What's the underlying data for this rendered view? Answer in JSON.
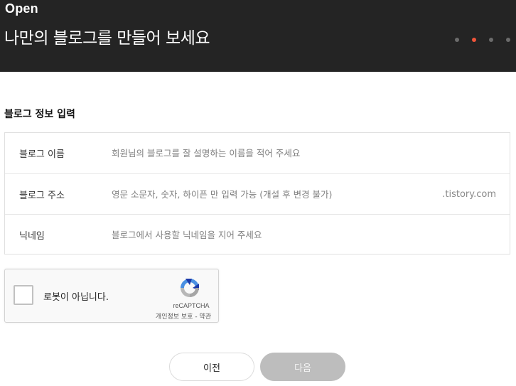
{
  "header": {
    "brand": "Open",
    "headline": "나만의 블로그를 만들어 보세요",
    "steps": {
      "total": 4,
      "active_index": 1
    },
    "colors": {
      "background": "#242424",
      "active_step": "#f0553a",
      "inactive_step": "#6b6b6b"
    }
  },
  "form": {
    "section_title": "블로그 정보 입력",
    "fields": [
      {
        "label": "블로그 이름",
        "value": "",
        "placeholder": "회원님의 블로그를 잘 설명하는 이름을 적어 주세요"
      },
      {
        "label": "블로그 주소",
        "value": "",
        "placeholder": "영문 소문자, 숫자, 하이픈 만 입력 가능 (개설 후 변경 불가)",
        "suffix": ".tistory.com"
      },
      {
        "label": "닉네임",
        "value": "",
        "placeholder": "블로그에서 사용할 닉네임을 지어 주세요"
      }
    ]
  },
  "recaptcha": {
    "label": "로봇이 아닙니다.",
    "brand": "reCAPTCHA",
    "links": "개인정보 보호 - 약관",
    "checked": false,
    "icon": "recaptcha-logo-icon"
  },
  "buttons": {
    "prev_label": "이전",
    "next_label": "다음",
    "next_enabled": false
  }
}
